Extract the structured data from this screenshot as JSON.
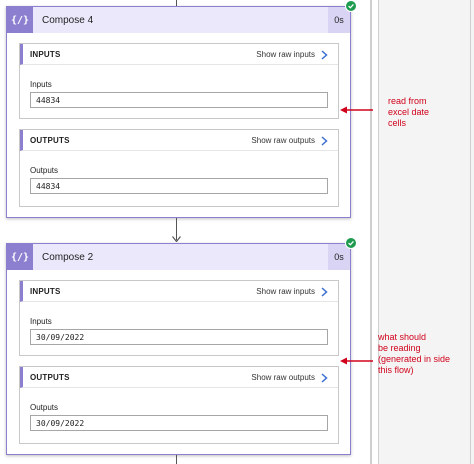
{
  "cards": [
    {
      "title": "Compose 4",
      "icon": "{/}",
      "duration": "0s",
      "inputs": {
        "header": "INPUTS",
        "raw_link": "Show raw inputs",
        "field_label": "Inputs",
        "value": "44834"
      },
      "outputs": {
        "header": "OUTPUTS",
        "raw_link": "Show raw outputs",
        "field_label": "Outputs",
        "value": "44834"
      }
    },
    {
      "title": "Compose 2",
      "icon": "{/}",
      "duration": "0s",
      "inputs": {
        "header": "INPUTS",
        "raw_link": "Show raw inputs",
        "field_label": "Inputs",
        "value": "30/09/2022"
      },
      "outputs": {
        "header": "OUTPUTS",
        "raw_link": "Show raw outputs",
        "field_label": "Outputs",
        "value": "30/09/2022"
      }
    }
  ],
  "annotations": [
    {
      "lines": [
        "read from",
        "excel date",
        "cells"
      ]
    },
    {
      "lines": [
        "what should",
        "be reading",
        "(generated in side",
        "this flow)"
      ]
    }
  ],
  "colors": {
    "accent": "#8c7fd0",
    "header_bg": "#ece8fb",
    "success": "#1e9b4f",
    "annotation": "#d0021b"
  },
  "icons": {
    "card_icon": "compose-icon",
    "status": "check-circle-icon",
    "raw_link": "chevron-right-icon",
    "connector": "arrow-down-icon"
  }
}
